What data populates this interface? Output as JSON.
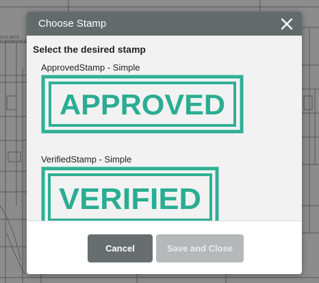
{
  "background": {
    "labels": [
      "SITE DECK",
      "CLASSROOM AN"
    ]
  },
  "dialog": {
    "title": "Choose Stamp",
    "prompt": "Select the desired stamp",
    "stamps": [
      {
        "name": "ApprovedStamp - Simple",
        "stamp_text": "APPROVED"
      },
      {
        "name": "VerifiedStamp - Simple",
        "stamp_text": "VERIFIED"
      }
    ],
    "buttons": {
      "cancel": "Cancel",
      "save": "Save and Close"
    },
    "close_icon": "close-icon"
  },
  "colors": {
    "header_bg": "#636a6c",
    "stamp_green": "#1aa88a",
    "cancel_bg": "#686e70",
    "save_disabled_bg": "#b5b7b8"
  }
}
